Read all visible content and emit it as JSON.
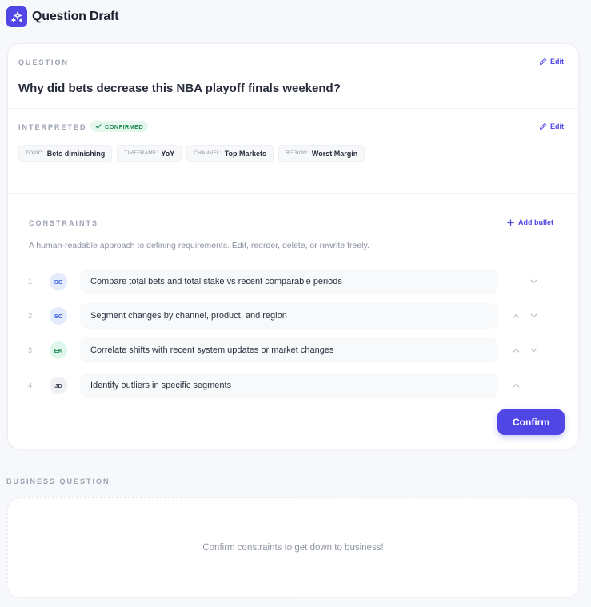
{
  "app": {
    "title": "Question Draft",
    "logo_icon": "sparkles-icon"
  },
  "question": {
    "label": "QUESTION",
    "edit_label": "Edit",
    "text": "Why did bets decrease this NBA playoff finals weekend?"
  },
  "interpreted": {
    "label": "INTERPRETED",
    "badge": "CONFIRMED",
    "edit_label": "Edit",
    "chips": [
      {
        "key": "TOPIC:",
        "value": "Bets diminishing"
      },
      {
        "key": "TIMEFRAME:",
        "value": "YoY"
      },
      {
        "key": "CHANNEL:",
        "value": "Top Markets"
      },
      {
        "key": "REGION:",
        "value": "Worst Margin"
      }
    ]
  },
  "constraints": {
    "label": "CONSTRAINTS",
    "add_label": "Add bullet",
    "description": "A human-readable approach to defining requirements. Edit, reorder, delete, or rewrite freely.",
    "items": [
      {
        "num": "1",
        "initials": "SC",
        "text": "Compare total bets and total stake vs recent comparable periods"
      },
      {
        "num": "2",
        "initials": "SC",
        "text": "Segment changes by channel, product, and region"
      },
      {
        "num": "3",
        "initials": "EK",
        "text": "Correlate shifts with recent system updates or market changes"
      },
      {
        "num": "4",
        "initials": "JD",
        "text": "Identify outliers in specific segments"
      }
    ],
    "confirm_label": "Confirm"
  },
  "business_question": {
    "label": "BUSINESS QUESTION",
    "empty_text": "Confirm constraints to get down to business!"
  },
  "colors": {
    "accent": "#4f46e5",
    "confirmed": "#1e8a55"
  }
}
